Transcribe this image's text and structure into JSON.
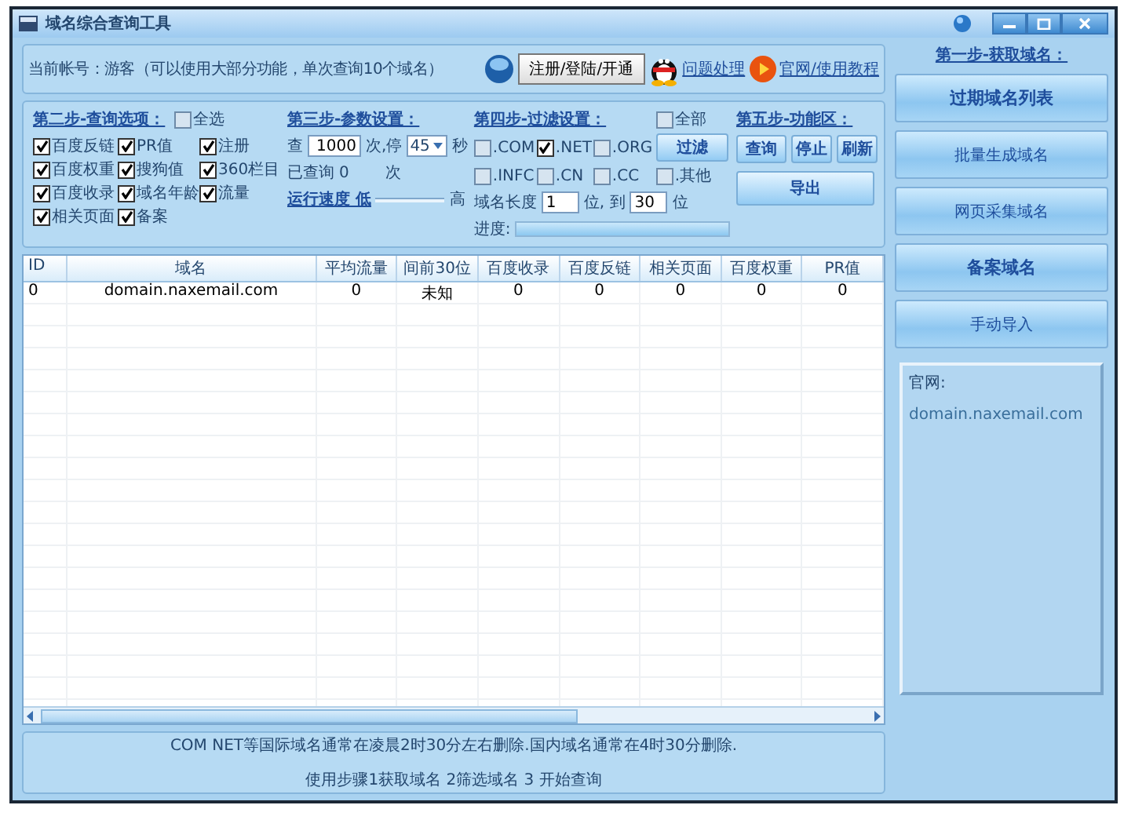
{
  "window": {
    "title": "域名综合查询工具"
  },
  "account_text": "当前帐号：游客（可以使用大部分功能，单次查询10个域名）",
  "register_button": "注册/登陆/开通",
  "links": [
    "问题处理",
    "官网/使用教程"
  ],
  "step2": {
    "title": "第二步-查询选项：",
    "select_all": {
      "label": "全选",
      "checked": false
    },
    "options": [
      {
        "label": "百度反链",
        "checked": true
      },
      {
        "label": "PR值",
        "checked": true
      },
      {
        "label": "注册",
        "checked": true
      },
      {
        "label": "百度权重",
        "checked": true
      },
      {
        "label": "搜狗值",
        "checked": true
      },
      {
        "label": "360栏目",
        "checked": true
      },
      {
        "label": "百度收录",
        "checked": true
      },
      {
        "label": "域名年龄",
        "checked": true
      },
      {
        "label": "流量",
        "checked": true
      },
      {
        "label": "相关页面",
        "checked": true
      },
      {
        "label": "备案",
        "checked": true
      }
    ]
  },
  "step3": {
    "title": "第三步-参数设置：",
    "query_label": "查",
    "query_value": "1000",
    "pause_label": "次,停",
    "pause_value": "45",
    "seconds_label": "秒",
    "queried_label": "已查询",
    "queried_value": "0",
    "times_label": "次",
    "speed_label": "运行速度 低",
    "speed_high": "高"
  },
  "step4": {
    "title": "第四步-过滤设置：",
    "all": {
      "label": "全部",
      "checked": false
    },
    "tlds": [
      {
        "label": ".COM",
        "checked": false
      },
      {
        "label": ".NET",
        "checked": true
      },
      {
        "label": ".ORG",
        "checked": false
      },
      {
        "label": ".INFC",
        "checked": false
      },
      {
        "label": ".CN",
        "checked": false
      },
      {
        "label": ".CC",
        "checked": false
      },
      {
        "label": ".其他",
        "checked": false
      }
    ],
    "filter_button": "过滤",
    "length_label": "域名长度",
    "length_from": "1",
    "to_label": "位, 到",
    "length_to": "30",
    "unit_label": "位",
    "progress_label": "进度:",
    "progress": {
      "level": 1
    }
  },
  "step5": {
    "title": "第五步-功能区：",
    "buttons": [
      "查询",
      "停止",
      "刷新"
    ],
    "export_button": "导出"
  },
  "table": {
    "columns": [
      "ID",
      "域名",
      "平均流量",
      "间前30位",
      "百度收录",
      "百度反链",
      "相关页面",
      "百度权重",
      "PR值"
    ],
    "rows": [
      [
        "0",
        "domain.naxemail.com",
        "0",
        "未知",
        "0",
        "0",
        "0",
        "0",
        "0"
      ]
    ]
  },
  "notes": [
    "COM NET等国际域名通常在凌晨2时30分左右删除.国内域名通常在4时30分删除.",
    "使用步骤1获取域名 2筛选域名 3 开始查询"
  ],
  "sidebar": {
    "title": "第一步-获取域名：",
    "buttons": [
      {
        "label": "过期域名列表",
        "emphasized": true
      },
      {
        "label": "批量生成域名",
        "emphasized": false
      },
      {
        "label": "网页采集域名",
        "emphasized": false
      },
      {
        "label": "备案域名",
        "emphasized": true
      },
      {
        "label": "手动导入",
        "emphasized": false
      }
    ],
    "site_label": "官网:",
    "site_url": "domain.naxemail.com"
  }
}
